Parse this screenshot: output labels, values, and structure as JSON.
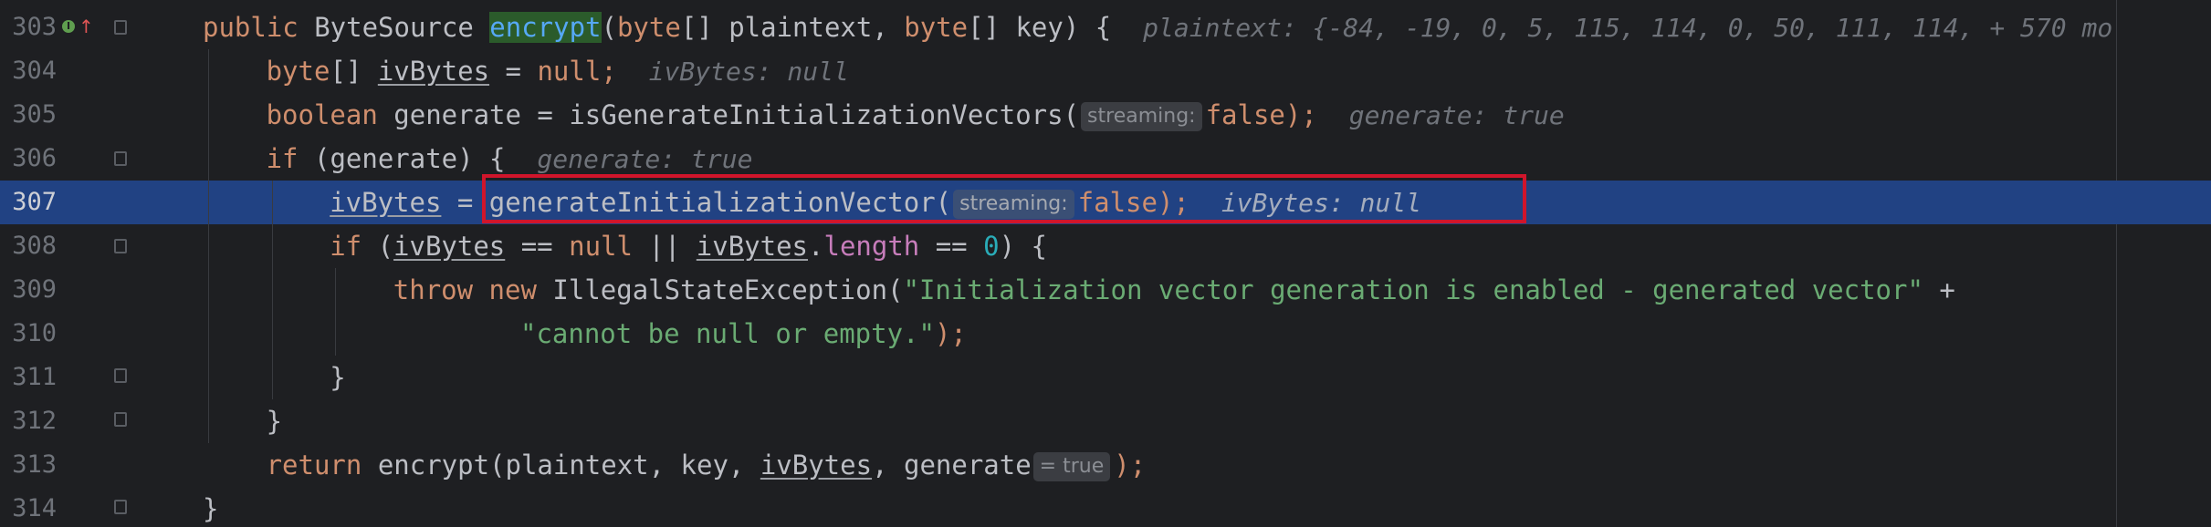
{
  "editor": {
    "lines": [
      {
        "number": "303",
        "segments": [
          {
            "t": "public ",
            "c": "kw"
          },
          {
            "t": "ByteSource ",
            "c": ""
          },
          {
            "t": "encrypt",
            "c": "fn-hl"
          },
          {
            "t": "(",
            "c": ""
          },
          {
            "t": "byte",
            "c": "kw"
          },
          {
            "t": "[] plaintext, ",
            "c": ""
          },
          {
            "t": "byte",
            "c": "kw"
          },
          {
            "t": "[] key) {  ",
            "c": ""
          },
          {
            "t": "plaintext: {-84, -19, 0, 5, 115, 114, 0, 50, 111, 114, + 570 mo",
            "c": "dbg"
          }
        ]
      },
      {
        "number": "304",
        "segments": [
          {
            "t": "byte",
            "c": "kw"
          },
          {
            "t": "[] ",
            "c": ""
          },
          {
            "t": "ivBytes",
            "c": "var-u"
          },
          {
            "t": " = ",
            "c": ""
          },
          {
            "t": "null",
            "c": "kw"
          },
          {
            "t": ";  ",
            "c": "kw"
          },
          {
            "t": "ivBytes: null",
            "c": "dbg"
          }
        ]
      },
      {
        "number": "305",
        "segments": [
          {
            "t": "boolean ",
            "c": "kw"
          },
          {
            "t": "generate = isGenerateInitializationVectors(",
            "c": ""
          },
          {
            "t": "streaming:",
            "c": "hint"
          },
          {
            "t": "false",
            "c": "kw"
          },
          {
            "t": ");  ",
            "c": "kw"
          },
          {
            "t": "generate: true",
            "c": "dbg"
          }
        ]
      },
      {
        "number": "306",
        "segments": [
          {
            "t": "if ",
            "c": "kw"
          },
          {
            "t": "(generate) {  ",
            "c": ""
          },
          {
            "t": "generate: true",
            "c": "dbg"
          }
        ]
      },
      {
        "number": "307",
        "current": true,
        "segments": [
          {
            "t": "ivBytes",
            "c": "var-u"
          },
          {
            "t": " = ",
            "c": ""
          },
          {
            "t": "generateInitializationVector(",
            "c": ""
          },
          {
            "t": "streaming:",
            "c": "hint cur"
          },
          {
            "t": "false",
            "c": "kw"
          },
          {
            "t": ");  ",
            "c": "kw"
          },
          {
            "t": "ivBytes: null",
            "c": "dbg"
          }
        ]
      },
      {
        "number": "308",
        "segments": [
          {
            "t": "if ",
            "c": "kw"
          },
          {
            "t": "(",
            "c": ""
          },
          {
            "t": "ivBytes",
            "c": "var-u"
          },
          {
            "t": " == ",
            "c": ""
          },
          {
            "t": "null",
            "c": "kw"
          },
          {
            "t": " || ",
            "c": ""
          },
          {
            "t": "ivBytes",
            "c": "var-u"
          },
          {
            "t": ".",
            "c": ""
          },
          {
            "t": "length",
            "c": "field"
          },
          {
            "t": " == ",
            "c": ""
          },
          {
            "t": "0",
            "c": "num"
          },
          {
            "t": ") {",
            "c": ""
          }
        ]
      },
      {
        "number": "309",
        "segments": [
          {
            "t": "throw new ",
            "c": "kw"
          },
          {
            "t": "IllegalStateException(",
            "c": ""
          },
          {
            "t": "\"Initialization vector generation is enabled - generated vector\"",
            "c": "str"
          },
          {
            "t": " +",
            "c": ""
          }
        ]
      },
      {
        "number": "310",
        "segments": [
          {
            "t": "\"cannot be null or empty.\"",
            "c": "str"
          },
          {
            "t": ");",
            "c": "kw"
          }
        ]
      },
      {
        "number": "311",
        "segments": [
          {
            "t": "}",
            "c": ""
          }
        ]
      },
      {
        "number": "312",
        "segments": [
          {
            "t": "}",
            "c": ""
          }
        ]
      },
      {
        "number": "313",
        "segments": [
          {
            "t": "return ",
            "c": "kw"
          },
          {
            "t": "encrypt(plaintext, key, ",
            "c": ""
          },
          {
            "t": "ivBytes",
            "c": "var-u"
          },
          {
            "t": ", generate",
            "c": ""
          },
          {
            "t": "= true",
            "c": "hint"
          },
          {
            "t": ");",
            "c": "kw"
          }
        ]
      },
      {
        "number": "314",
        "segments": [
          {
            "t": "}",
            "c": ""
          }
        ]
      }
    ]
  },
  "icons": {
    "line_303": [
      "implements-icon",
      "override-up-arrow-icon"
    ]
  },
  "colors": {
    "background": "#1e1f22",
    "current_line": "#214283",
    "keyword": "#cf8e6d",
    "string": "#6aab73",
    "number": "#2aacb8",
    "field": "#c77dbb",
    "highlight_box": "#d0152b"
  }
}
